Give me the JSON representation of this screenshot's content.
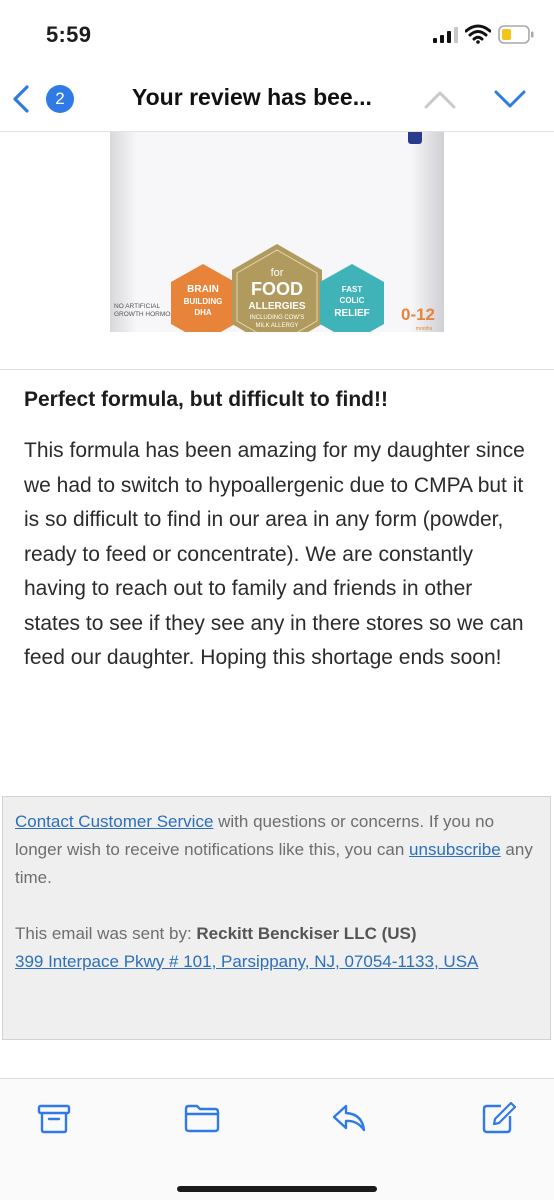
{
  "status_bar": {
    "time": "5:59"
  },
  "nav": {
    "unread_count": "2",
    "title": "Your review has bee..."
  },
  "product": {
    "badges": {
      "left": [
        "BRAIN",
        "BUILDING",
        "DHA"
      ],
      "center_top": "for",
      "center_main": "FOOD",
      "center_sub": "ALLERGIES",
      "center_small1": "INCLUDING COW'S",
      "center_small2": "MILK ALLERGY",
      "right": [
        "FAST",
        "COLIC",
        "RELIEF"
      ]
    },
    "side_note": [
      "NO ARTIFICIAL",
      "GROWTH HORMONES"
    ],
    "age": "0-12",
    "age_unit": "months"
  },
  "review": {
    "title": "Perfect formula, but difficult to find!!",
    "body": "This formula has been amazing for my daughter since we had to switch to hypoallergenic due to CMPA but it is so difficult to find in our area in any form (powder, ready to feed or concentrate). We are constantly having to reach out to family and friends in other states to see if they see any in there stores so we can feed our daughter. Hoping this shortage ends soon!"
  },
  "footer": {
    "contact_link": "Contact Customer Service",
    "contact_text": " with questions or concerns. If you no longer wish to receive notifications like this, you can ",
    "unsubscribe_link": "unsubscribe",
    "unsubscribe_tail": " any time.",
    "sent_by_label": "This email was sent by: ",
    "company": "Reckitt Benckiser LLC (US)",
    "address": "399 Interpace Pkwy # 101, Parsippany, NJ, 07054-1133, USA"
  },
  "toolbar": {
    "icons": [
      "archive-icon",
      "folder-icon",
      "reply-icon",
      "compose-icon"
    ]
  },
  "colors": {
    "accent": "#2f7ae5",
    "link": "#2c6fbd",
    "badge_orange": "#e8833a",
    "badge_gold": "#b09a5e",
    "badge_teal": "#3fb3b8",
    "age_orange": "#e8833a"
  }
}
